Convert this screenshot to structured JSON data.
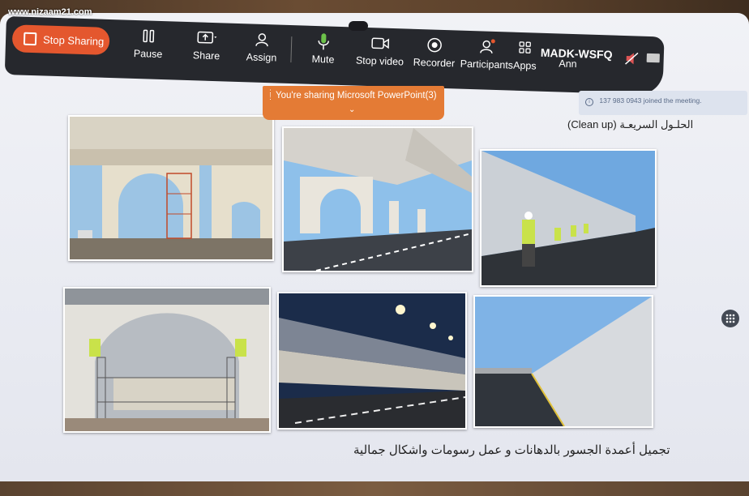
{
  "watermark": "www.nizaam21.com",
  "toolbar": {
    "stop_sharing": "Stop Sharing",
    "pause": "Pause",
    "share": "Share",
    "assign": "Assign",
    "mute": "Mute",
    "stop_video": "Stop video",
    "recorder": "Recorder",
    "participants": "Participants",
    "apps": "Apps",
    "annotate_partial": "Ann",
    "meeting_id": "MADK-WSFQ"
  },
  "sharing_banner": "You're sharing Microsoft PowerPoint(3)",
  "notification": "137 983 0943 joined the meeting.",
  "slide": {
    "title": "الحلـول السريعـة  (Clean up)",
    "caption": "تجميل أعمدة الجسور بالدهانات و عمل رسومات واشكال جمالية",
    "photos": [
      "bridge-arches-scaffold",
      "bridge-underpass-road",
      "wall-cleaning-workers",
      "arch-painting-scaffold",
      "bridge-night-lights",
      "long-wall-road"
    ]
  },
  "colors": {
    "toolbar": "#26282d",
    "accent": "#e4572e",
    "banner": "#e47b35"
  }
}
